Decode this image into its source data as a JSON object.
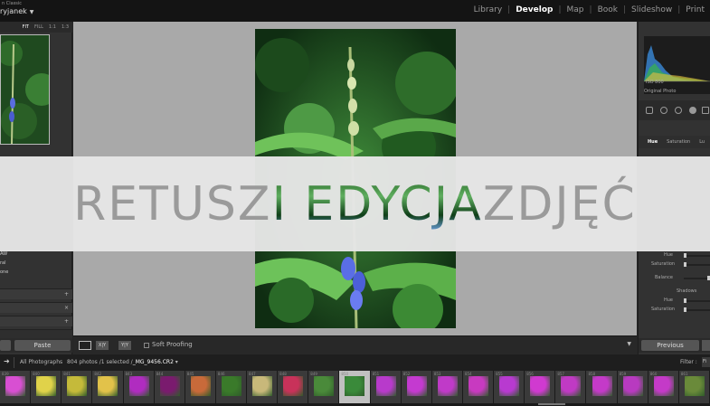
{
  "app": {
    "brand_small": "n Classic",
    "brand_name": "ryjanek",
    "modules": [
      "Library",
      "Develop",
      "Map",
      "Book",
      "Slideshow",
      "Print"
    ],
    "active_module": "Develop"
  },
  "navigator": {
    "fit": "FIT",
    "fill": "FILL",
    "one_one": "1:1",
    "ratio": "1:3"
  },
  "left_panel": {
    "preset_items": [
      "AW",
      "ral",
      "one"
    ],
    "paste_label": "Paste"
  },
  "toolbar": {
    "compare": "X|Y",
    "before_after": "Y|Y",
    "soft_proofing": "Soft Proofing"
  },
  "right_panel": {
    "iso": "ISO 800",
    "original": "Original Photo",
    "hsl_tabs": [
      "Hue",
      "Saturation",
      "Lu"
    ],
    "labels": [
      "Hue",
      "Saturation",
      "Balance",
      "Shadows",
      "Hue",
      "Saturation"
    ],
    "previous_label": "Previous"
  },
  "filmstrip_bar": {
    "source": "All Photographs",
    "info": "804 photos /1 selected /",
    "filename": "_MG_9456.CR2",
    "filter_label": "Filter :",
    "filter_value": "Fi"
  },
  "filmstrip": {
    "numbers": [
      "839",
      "840",
      "841",
      "842",
      "843",
      "844",
      "845",
      "846",
      "847",
      "848",
      "849",
      "850",
      "851",
      "852",
      "853",
      "854",
      "855",
      "856",
      "857",
      "858",
      "859",
      "860",
      "861"
    ],
    "colors": [
      "#d84fd2",
      "#e0d24a",
      "#c5ba3a",
      "#e2c24a",
      "#b02cc0",
      "#7a1b6e",
      "#c86a3a",
      "#3a7a2a",
      "#c8b87a",
      "#c8325a",
      "#4a8a3a",
      "#3a8a3a",
      "#b83acb",
      "#c43ad0",
      "#c03ac8",
      "#c83ac0",
      "#b83ad0",
      "#d03ad0",
      "#c03ac4",
      "#c43ac8",
      "#b83ac0",
      "#c43ac8",
      "#6a8a3a"
    ],
    "selected_index": 11
  },
  "banner": {
    "part1": "RETUSZ ",
    "part2": "I EDYCJA",
    "part3": " ZDJĘĆ"
  },
  "colors": {
    "banner_bg": "#e6e6e6",
    "banner_text": "#9a9a9a",
    "canvas_bg": "#a9a9a9"
  }
}
